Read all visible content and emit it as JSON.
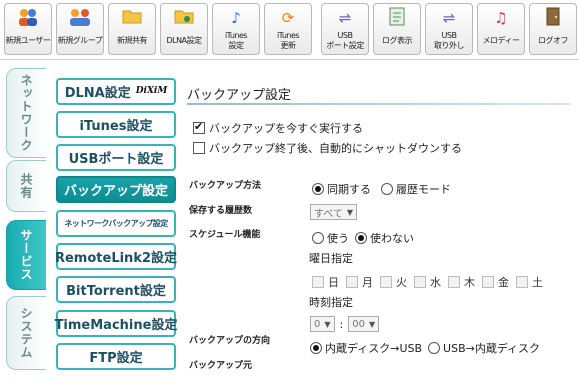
{
  "toolbar": {
    "buttons": [
      {
        "label": "新規ユーザー",
        "icon": "users-icon"
      },
      {
        "label": "新規グループ",
        "icon": "group-icon"
      },
      {
        "label": "新規共有",
        "icon": "folder-icon"
      },
      {
        "label": "DLNA設定",
        "icon": "dlna-folder-icon"
      },
      {
        "label": "iTunes\n設定",
        "icon": "music-note-icon"
      },
      {
        "label": "iTunes\n更新",
        "icon": "itunes-refresh-icon"
      },
      {
        "label": "USB\nポート設定",
        "icon": "usb-icon"
      },
      {
        "label": "ログ表示",
        "icon": "log-document-icon"
      },
      {
        "label": "USB\n取り外し",
        "icon": "usb-remove-icon"
      },
      {
        "label": "メロディー",
        "icon": "melody-icon"
      },
      {
        "label": "ログオフ",
        "icon": "logoff-door-icon"
      }
    ]
  },
  "side_tabs": [
    {
      "label": "ネットワーク",
      "active": false
    },
    {
      "label": "共有",
      "active": false
    },
    {
      "label": "サービス",
      "active": true
    },
    {
      "label": "システム",
      "active": false
    }
  ],
  "submenu": [
    {
      "label": "DLNA設定",
      "badge": "DiXiM"
    },
    {
      "label": "iTunes設定"
    },
    {
      "label": "USBポート設定"
    },
    {
      "label": "バックアップ設定",
      "active": true
    },
    {
      "label": "ネットワークバックアップ設定"
    },
    {
      "label": "RemoteLink2設定"
    },
    {
      "label": "BitTorrent設定"
    },
    {
      "label": "TimeMachine設定"
    },
    {
      "label": "FTP設定"
    }
  ],
  "main": {
    "title": "バックアップ設定",
    "run_now_label": "バックアップを今すぐ実行する",
    "run_now_checked": true,
    "shutdown_label": "バックアップ終了後、自動的にシャットダウンする",
    "shutdown_checked": false,
    "method": {
      "label": "バックアップ方法",
      "options": [
        "同期する",
        "履歴モード"
      ],
      "selected": "同期する"
    },
    "history_count": {
      "label": "保存する履歴数",
      "value": "すべて"
    },
    "schedule": {
      "label": "スケジュール機能",
      "options": [
        "使う",
        "使わない"
      ],
      "selected": "使わない"
    },
    "day_label": "曜日指定",
    "days": [
      "日",
      "月",
      "火",
      "水",
      "木",
      "金",
      "土"
    ],
    "time_label": "時刻指定",
    "time_hour": "0",
    "time_sep": ":",
    "time_minute": "00",
    "direction": {
      "label": "バックアップの方向",
      "options": [
        "内蔵ディスク→USB",
        "USB→内蔵ディスク"
      ],
      "selected": "内蔵ディスク→USB"
    },
    "source_label": "バックアップ元"
  },
  "colors": {
    "accent": "#17a2a8",
    "accent_border": "#3bb3b6",
    "submenu_text": "#1f4f63"
  }
}
